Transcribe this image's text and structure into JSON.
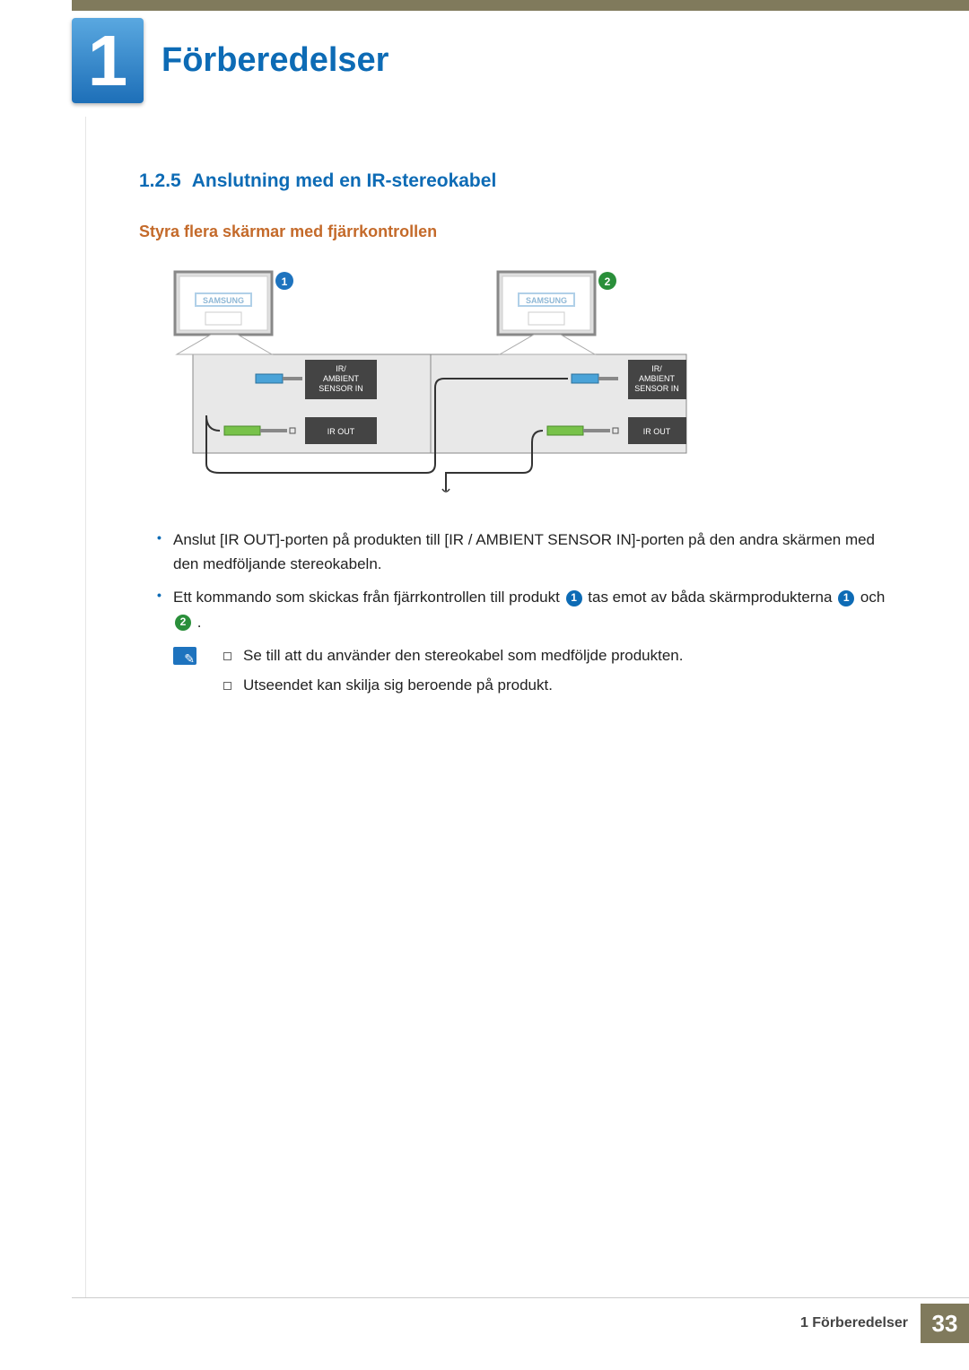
{
  "chapter": {
    "number": "1",
    "title": "Förberedelser"
  },
  "section": {
    "number": "1.2.5",
    "title": "Anslutning med en IR-stereokabel"
  },
  "subheading": "Styra flera skärmar med fjärrkontrollen",
  "diagram": {
    "monitor_brand": "SAMSUNG",
    "badge1": "1",
    "badge2": "2",
    "port_in_l1": "IR/",
    "port_in_l2": "AMBIENT",
    "port_in_l3": "SENSOR IN",
    "port_out": "IR OUT"
  },
  "bullets": {
    "item1": "Anslut [IR OUT]-porten på produkten till [IR / AMBIENT SENSOR IN]-porten på den andra skärmen med den medföljande stereokabeln.",
    "item2_a": "Ett kommando som skickas från fjärrkontrollen till produkt ",
    "item2_b": " tas emot av båda skärmprodukterna ",
    "item2_c": " och ",
    "item2_d": " .",
    "badge1": "1",
    "badge2": "2"
  },
  "notes": {
    "item1": "Se till att du använder den stereokabel som medföljde produkten.",
    "item2": "Utseendet kan skilja sig beroende på produkt."
  },
  "footer": {
    "chapter_ref": "1 Förberedelser",
    "page": "33"
  }
}
